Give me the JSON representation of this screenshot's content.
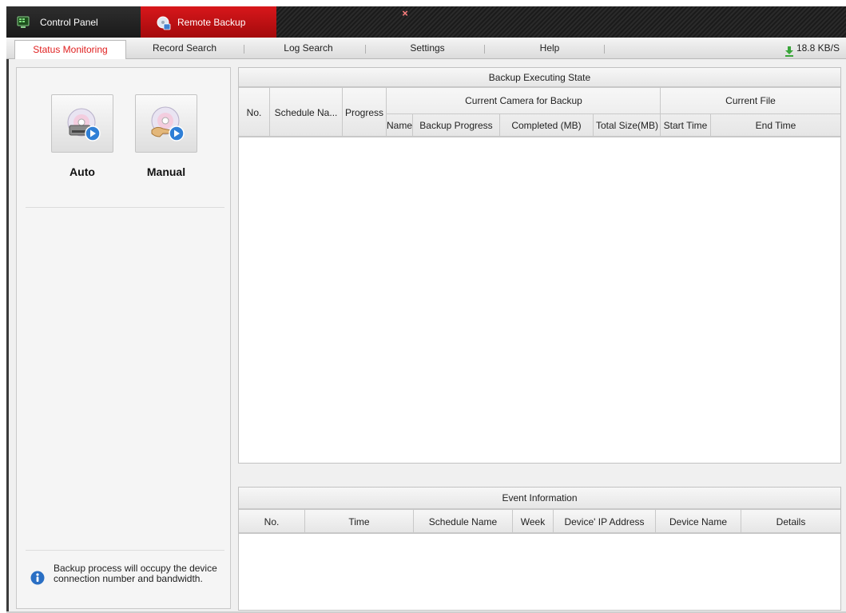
{
  "titlebar": {
    "tabs": [
      {
        "label": "Control Panel",
        "icon": "control-panel-icon"
      },
      {
        "label": "Remote Backup",
        "icon": "remote-backup-icon"
      }
    ],
    "close_glyph": "×"
  },
  "subtabs": {
    "items": [
      {
        "label": "Status Monitoring",
        "active": true
      },
      {
        "label": "Record Search"
      },
      {
        "label": "Log Search"
      },
      {
        "label": "Settings"
      },
      {
        "label": "Help"
      }
    ],
    "speed": "18.8 KB/S",
    "active_color": "#e02020"
  },
  "left_panel": {
    "auto_label": "Auto",
    "manual_label": "Manual",
    "info_text": "Backup process will occupy the device connection number and bandwidth."
  },
  "backup_table": {
    "title": "Backup Executing State",
    "col_no": "No.",
    "col_schedule": "Schedule Na...",
    "col_progress": "Progress",
    "group_camera": "Current  Camera for Backup",
    "group_file": "Current File",
    "col_name": "Name",
    "col_backup_progress": "Backup Progress",
    "col_completed": "Completed (MB)",
    "col_total": "Total Size(MB)",
    "col_start": "Start Time",
    "col_end": "End Time",
    "rows": []
  },
  "event_table": {
    "title": "Event Information",
    "columns": [
      "No.",
      "Time",
      "Schedule Name",
      "Week",
      "Device' IP Address",
      "Device Name",
      "Details"
    ],
    "rows": []
  },
  "colors": {
    "titlebar_bg": "#1b1b1b",
    "remote_tab_red": "#c41013",
    "speed_icon_green": "#3aa53a",
    "info_icon_blue": "#2a6fc4"
  }
}
